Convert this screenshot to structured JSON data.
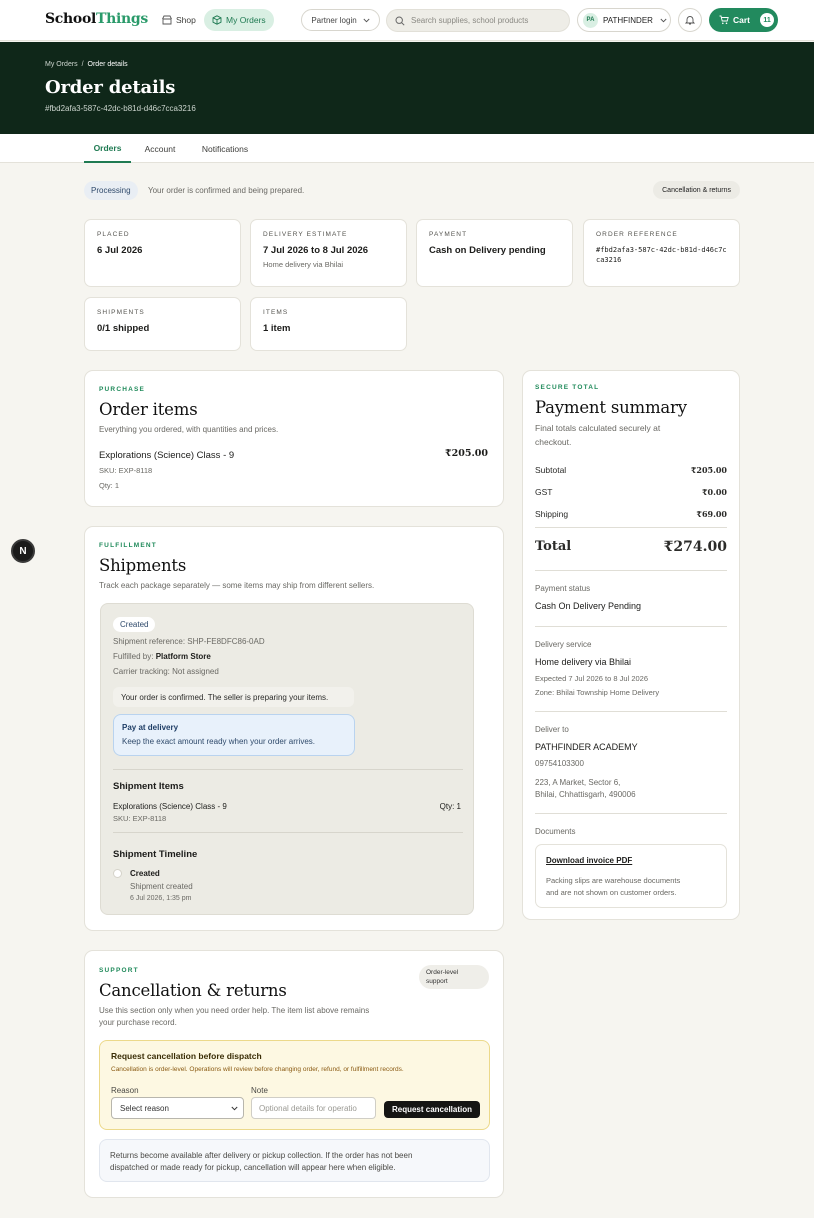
{
  "header": {
    "logo_main": "School",
    "logo_accent": "Things",
    "nav_shop": "Shop",
    "nav_orders": "My Orders",
    "partner_login": "Partner login",
    "search_placeholder": "Search supplies, school products",
    "account_initials": "PA",
    "account_name": "PATHFINDER",
    "cart_label": "Cart",
    "cart_count": "11"
  },
  "hero": {
    "breadcrumb_parent": "My Orders",
    "breadcrumb_sep": "/",
    "breadcrumb_current": "Order details",
    "title": "Order details",
    "order_id": "#fbd2afa3-587c-42dc-b81d-d46c7cca3216"
  },
  "tabs": [
    "Orders",
    "Account",
    "Notifications"
  ],
  "status": {
    "badge": "Processing",
    "message": "Your order is confirmed and being prepared.",
    "cancel_link": "Cancellation & returns"
  },
  "info_cards": {
    "placed": {
      "label": "PLACED",
      "value": "6 Jul 2026"
    },
    "delivery": {
      "label": "DELIVERY ESTIMATE",
      "value": "7 Jul 2026 to 8 Jul 2026",
      "sub": "Home delivery via Bhilai"
    },
    "payment": {
      "label": "PAYMENT",
      "value": "Cash on Delivery pending"
    },
    "reference": {
      "label": "ORDER REFERENCE",
      "value": "#fbd2afa3-587c-42dc-b81d-d46c7cca3216"
    },
    "shipments": {
      "label": "SHIPMENTS",
      "value": "0/1 shipped"
    },
    "items": {
      "label": "ITEMS",
      "value": "1 item"
    }
  },
  "order_items": {
    "eyebrow": "PURCHASE",
    "title": "Order items",
    "desc": "Everything you ordered, with quantities and prices.",
    "items": [
      {
        "name": "Explorations (Science) Class - 9",
        "price": "₹205.00",
        "sku": "SKU: EXP-8118",
        "qty": "Qty: 1"
      }
    ]
  },
  "shipments": {
    "eyebrow": "FULFILLMENT",
    "title": "Shipments",
    "desc": "Track each package separately — some items may ship from different sellers.",
    "status": "Created",
    "reference": "Shipment reference: SHP-FE8DFC86-0AD",
    "fulfilled_prefix": "Fulfilled by:",
    "fulfilled_by": "Platform Store",
    "tracking": "Carrier tracking: Not assigned",
    "notice": "Your order is confirmed. The seller is preparing your items.",
    "pay_title": "Pay at delivery",
    "pay_desc": "Keep the exact amount ready when your order arrives.",
    "items_heading": "Shipment Items",
    "item_name": "Explorations (Science) Class - 9",
    "item_qty": "Qty: 1",
    "item_sku": "SKU: EXP-8118",
    "timeline_heading": "Shipment Timeline",
    "timeline": [
      {
        "title": "Created",
        "desc": "Shipment created",
        "time": "6 Jul 2026, 1:35 pm"
      }
    ]
  },
  "summary": {
    "eyebrow": "SECURE TOTAL",
    "title": "Payment summary",
    "desc_line1": "Final totals calculated securely at",
    "desc_line2": "checkout.",
    "rows": [
      {
        "label": "Subtotal",
        "value": "₹205.00"
      },
      {
        "label": "GST",
        "value": "₹0.00"
      },
      {
        "label": "Shipping",
        "value": "₹69.00"
      }
    ],
    "total_label": "Total",
    "total_value": "₹274.00",
    "payment_status_label": "Payment status",
    "payment_status": "Cash On Delivery Pending",
    "delivery_label": "Delivery service",
    "delivery_service": "Home delivery via Bhilai",
    "delivery_expected": "Expected 7 Jul 2026 to 8 Jul 2026",
    "delivery_zone": "Zone: Bhilai Township Home Delivery",
    "deliver_to_label": "Deliver to",
    "deliver_name": "PATHFINDER ACADEMY",
    "deliver_phone": "09754103300",
    "deliver_addr1": "223, A Market, Sector 6,",
    "deliver_addr2": "Bhilai, Chhattisgarh, 490006",
    "documents_label": "Documents",
    "invoice_link": "Download invoice PDF",
    "documents_note_line1": "Packing slips are warehouse documents",
    "documents_note_line2": "and are not shown on customer orders."
  },
  "cancellation": {
    "eyebrow": "SUPPORT",
    "title": "Cancellation & returns",
    "badge_line1": "Order-level",
    "badge_line2": "support",
    "desc_line1": "Use this section only when you need order help. The item list above remains",
    "desc_line2": "your purchase record.",
    "box_title": "Request cancellation before dispatch",
    "box_desc": "Cancellation is order-level. Operations will review before changing order, refund, or fulfillment records.",
    "reason_label": "Reason",
    "reason_selected": "Select reason",
    "note_label": "Note",
    "note_placeholder": "Optional details for operatio",
    "request_button": "Request cancellation",
    "returns_line1": "Returns become available after delivery or pickup collection. If the order has not been",
    "returns_line2": "dispatched or made ready for pickup, cancellation will appear here when eligible."
  },
  "devtools_badge": "N"
}
